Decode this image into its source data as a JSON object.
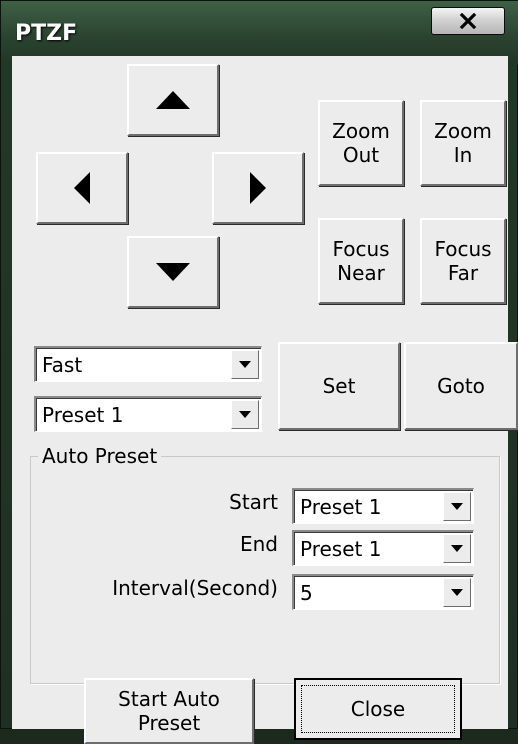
{
  "window": {
    "title": "PTZF"
  },
  "titlebar": {
    "close_icon": "close-x-icon"
  },
  "direction_pad": {
    "up_icon": "arrow-up-icon",
    "down_icon": "arrow-down-icon",
    "left_icon": "arrow-left-icon",
    "right_icon": "arrow-right-icon"
  },
  "zoom": {
    "out_label": "Zoom\nOut",
    "in_label": "Zoom\nIn"
  },
  "focus": {
    "near_label": "Focus\nNear",
    "far_label": "Focus\nFar"
  },
  "speed": {
    "selected": "Fast"
  },
  "preset": {
    "selected": "Preset 1",
    "set_label": "Set",
    "goto_label": "Goto"
  },
  "auto_preset": {
    "group_label": "Auto Preset",
    "start_label": "Start",
    "start_value": "Preset 1",
    "end_label": "End",
    "end_value": "Preset 1",
    "interval_label": "Interval(Second)",
    "interval_value": "5"
  },
  "footer": {
    "start_auto_label": "Start Auto\nPreset",
    "close_label": "Close"
  },
  "colors": {
    "face": "#ececec",
    "title_bar": "#2a4430"
  }
}
